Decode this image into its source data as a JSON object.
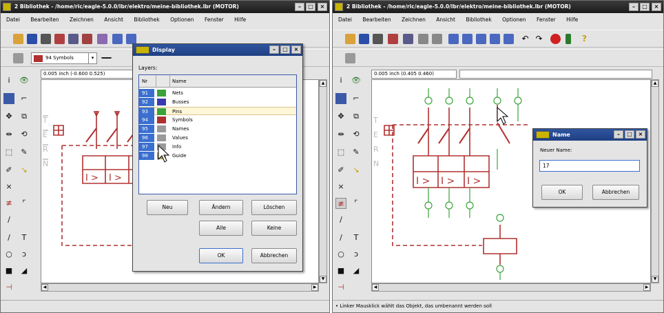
{
  "left_window": {
    "title": "2 Bibliothek - /home/ric/eagle-5.0.0/lbr/elektro/meine-bibliothek.lbr (MOTOR)",
    "menu": [
      "Datei",
      "Bearbeiten",
      "Zeichnen",
      "Ansicht",
      "Bibliothek",
      "Optionen",
      "Fenster",
      "Hilfe"
    ],
    "layer_select": "94 Symbols",
    "coord": "0.005 inch (-0.600 0.525)",
    "schematic_labels": {
      "t": "T",
      "e": "E",
      "r": "R",
      "n": "N",
      "i1": "I >",
      "i2": "I >"
    }
  },
  "display_dialog": {
    "title": "Display",
    "layers_label": "Layers:",
    "col_nr": "Nr",
    "col_name": "Name",
    "layers": [
      {
        "nr": "91",
        "name": "Nets",
        "color": "#3aa33a"
      },
      {
        "nr": "92",
        "name": "Busses",
        "color": "#3a3ab0"
      },
      {
        "nr": "93",
        "name": "Pins",
        "color": "#3aa33a"
      },
      {
        "nr": "94",
        "name": "Symbols",
        "color": "#b03030"
      },
      {
        "nr": "95",
        "name": "Names",
        "color": "#9a9a9a"
      },
      {
        "nr": "96",
        "name": "Values",
        "color": "#9a9a9a"
      },
      {
        "nr": "97",
        "name": "Info",
        "color": "#9a9a9a"
      },
      {
        "nr": "98",
        "name": "Guide",
        "color": "#a6a050"
      }
    ],
    "buttons": {
      "neu": "Neu",
      "aendern": "Ändern",
      "loeschen": "Löschen",
      "alle": "Alle",
      "keine": "Keine",
      "ok": "OK",
      "abbrechen": "Abbrechen"
    }
  },
  "right_window": {
    "title": "2 Bibliothek - /home/ric/eagle-5.0.0/lbr/elektro/meine-bibliothek.lbr (MOTOR)",
    "menu": [
      "Datei",
      "Bearbeiten",
      "Zeichnen",
      "Ansicht",
      "Bibliothek",
      "Optionen",
      "Fenster",
      "Hilfe"
    ],
    "coord": "0.005 inch (0.405 0.460)",
    "status": "Linker Mausklick wählt das Objekt, das umbenannt werden soll",
    "schematic_labels": {
      "t": "T",
      "e": "E",
      "r": "R",
      "n": "N",
      "i1": "I >",
      "i2": "I >",
      "i3": "I >"
    }
  },
  "name_dialog": {
    "title": "Name",
    "label": "Neuer Name:",
    "value": "17",
    "ok": "OK",
    "abbrechen": "Abbrechen"
  },
  "colors": {
    "symbol": "#b03030",
    "pin": "#3aa33a",
    "dialog_title": "#2f55a0",
    "selection": "#3a6fd0"
  }
}
